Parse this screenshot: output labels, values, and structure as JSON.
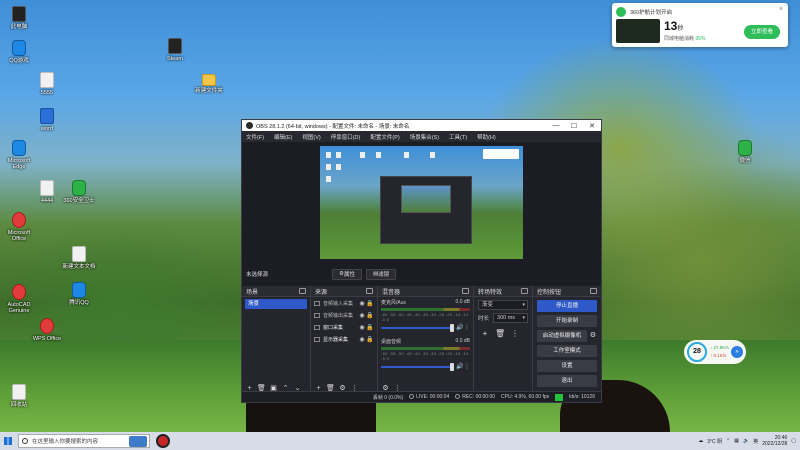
{
  "desktop": {
    "icons": [
      {
        "label": "此电脑",
        "type": "dark"
      },
      {
        "label": "QQ游戏",
        "type": "blue"
      },
      {
        "label": "Microsoft Edge",
        "type": "blue"
      },
      {
        "label": "5555",
        "type": "doc"
      },
      {
        "label": "word",
        "type": "word"
      },
      {
        "label": "Microsoft Office",
        "type": "red"
      },
      {
        "label": "AutoCAD Genuine",
        "type": "red"
      },
      {
        "label": "WPS Office",
        "type": "red"
      },
      {
        "label": "4444",
        "type": "doc"
      },
      {
        "label": "360安全卫士",
        "type": "green"
      },
      {
        "label": "腾讯QQ",
        "type": "blue"
      },
      {
        "label": "新建文本文档",
        "type": "doc"
      },
      {
        "label": "Steam",
        "type": "dark"
      },
      {
        "label": "新建文件夹",
        "type": "folder"
      },
      {
        "label": "微信",
        "type": "green"
      },
      {
        "label": "回收站",
        "type": "doc"
      }
    ]
  },
  "notification": {
    "title": "360护航计划开启",
    "close": "×",
    "number": "13",
    "number_unit": "秒",
    "subtitle": "同城电脑消耗",
    "subtitle_highlight": "95%",
    "button": "立即查看"
  },
  "weather_widget": {
    "temp": "28",
    "line1": "↓ 27.8K/s",
    "line2": "↑ 0.1K/s",
    "go": "»"
  },
  "obs": {
    "title": "OBS 28.1.2 (64-bit, windows) - 配置文件: 未命名 - 场景: 未命名",
    "window_buttons": [
      "—",
      "☐",
      "✕"
    ],
    "menu": [
      "文件(F)",
      "编辑(E)",
      "视图(V)",
      "停靠窗口(D)",
      "配置文件(P)",
      "场景集合(S)",
      "工具(T)",
      "帮助(H)"
    ],
    "scene_bar": {
      "current_scene": "未选择源",
      "properties": "属性",
      "filters": "滤镜"
    },
    "docks": {
      "scenes": {
        "title": "场景",
        "items": [
          "场景"
        ]
      },
      "sources": {
        "title": "来源",
        "items": [
          {
            "name": "音频输入采集"
          },
          {
            "name": "音频输出采集"
          },
          {
            "name": "窗口采集"
          },
          {
            "name": "显示器采集"
          }
        ]
      },
      "mixer": {
        "title": "混音器",
        "channels": [
          {
            "name": "麦克风/Aux",
            "db": "0.0 dB"
          },
          {
            "name": "桌面音频",
            "db": "0.0 dB"
          }
        ],
        "scale": "-60 -55 -50 -45 -40 -35 -30 -25 -20 -15 -10 -5 0"
      },
      "transitions": {
        "title": "转场特效",
        "type": "渐变",
        "duration_label": "时长",
        "duration": "300 ms"
      },
      "controls": {
        "title": "控制按钮",
        "buttons": [
          "停止直播",
          "开始录制",
          "启动虚拟摄像机",
          "工作室模式",
          "设置",
          "退出"
        ]
      }
    },
    "status": {
      "dropped": "丢帧 0 (0.0%)",
      "live": "LIVE: 00:00:04",
      "rec": "REC: 00:00:00",
      "cpu": "CPU: 4.9%, 60.00 fps",
      "kbps": "kb/s: 10126"
    }
  },
  "taskbar": {
    "search_placeholder": "在这里输入你要搜索的内容",
    "weather": "3°C 阴",
    "lang": "英",
    "time": "20:46",
    "date": "2022/12/28"
  }
}
